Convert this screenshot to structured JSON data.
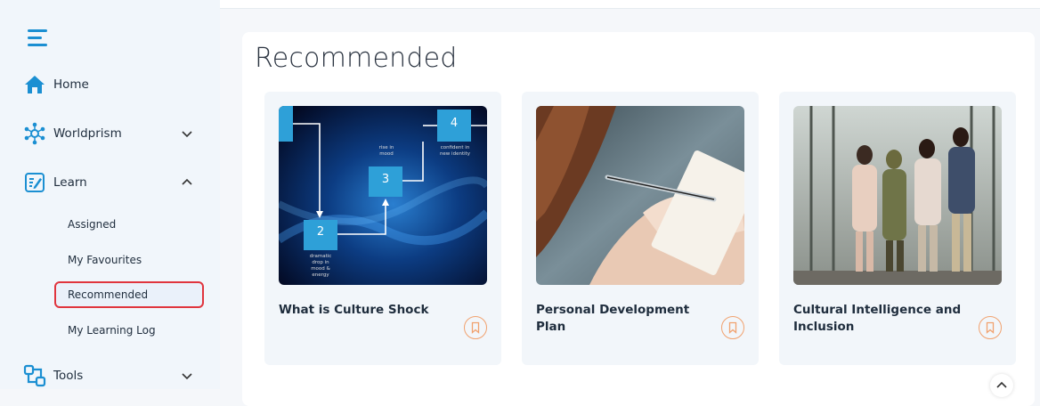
{
  "sidebar": {
    "items": [
      {
        "label": "Home",
        "icon": "home-icon"
      },
      {
        "label": "Worldprism",
        "icon": "network-icon",
        "chevron": "down"
      },
      {
        "label": "Learn",
        "icon": "book-icon",
        "chevron": "up"
      },
      {
        "label": "Tools",
        "icon": "tools-icon",
        "chevron": "down"
      }
    ],
    "learn_sub": [
      {
        "label": "Assigned"
      },
      {
        "label": "My Favourites"
      },
      {
        "label": "Recommended",
        "active": true
      },
      {
        "label": "My Learning Log"
      }
    ]
  },
  "main": {
    "title": "Recommended",
    "cards": [
      {
        "title": "What is Culture Shock",
        "thumb_steps": [
          "2",
          "3",
          "4"
        ],
        "thumb_captions": [
          "rise in mood",
          "confident in new identity",
          "dramatic drop in mood & energy"
        ]
      },
      {
        "title": "Personal Development Plan"
      },
      {
        "title": "Cultural Intelligence and Inclusion"
      }
    ]
  },
  "colors": {
    "accent": "#1b8fd2",
    "highlight": "#e0353e",
    "bookmark": "#f1a26f"
  }
}
